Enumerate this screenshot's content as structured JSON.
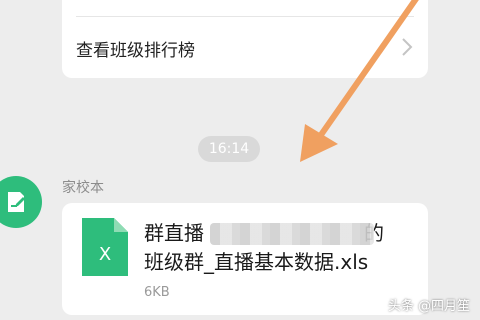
{
  "top_card": {
    "label": "查看班级排行榜",
    "chevron_icon": "chevron-right-icon"
  },
  "timestamp": "16:14",
  "message": {
    "sender": "家校本",
    "avatar_icon": "note-edit-icon",
    "file": {
      "icon": "excel-file-icon",
      "icon_letter": "X",
      "icon_color": "#2ebd7c",
      "name_prefix": "群直播",
      "name_suffix": "的",
      "name_line2": "班级群_直播基本数据.xls",
      "size": "6KB"
    }
  },
  "watermark": "头条 @四月笙",
  "colors": {
    "accent_green": "#2ebd7c",
    "arrow": "#f0a060",
    "background": "#ededed"
  }
}
